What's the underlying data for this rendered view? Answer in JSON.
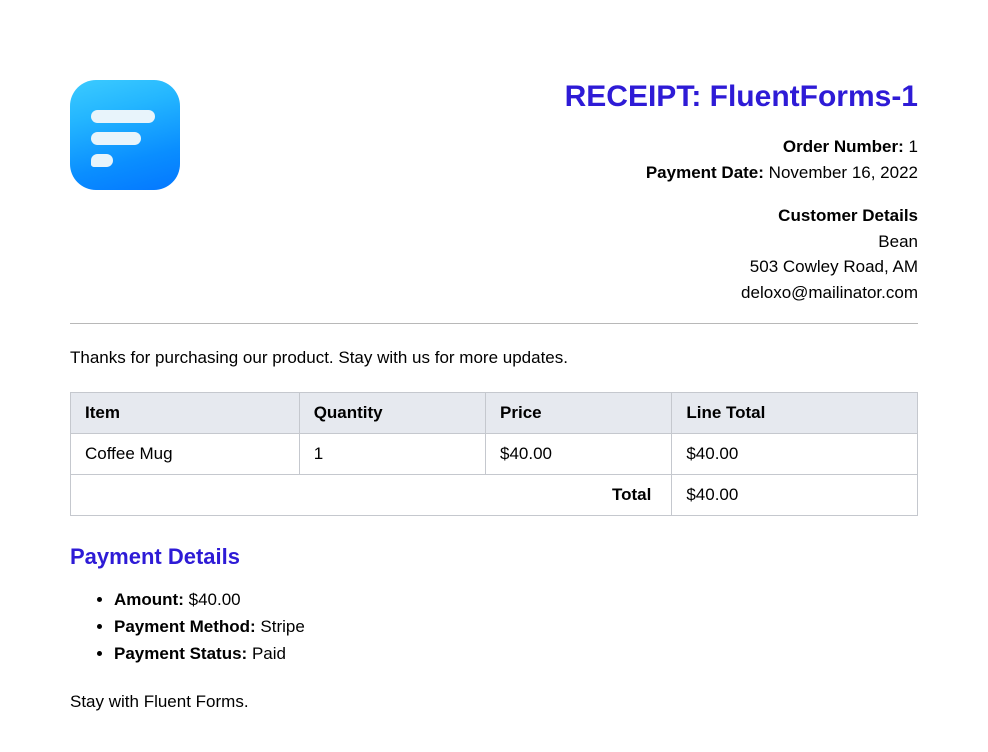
{
  "receipt": {
    "title": "RECEIPT: FluentForms-1",
    "order_number_label": "Order Number:",
    "order_number": "1",
    "payment_date_label": "Payment Date:",
    "payment_date": "November 16, 2022",
    "customer_details_label": "Customer Details",
    "customer_name": "Bean",
    "customer_address": "503 Cowley Road, AM",
    "customer_email": "deloxo@mailinator.com"
  },
  "thanks": "Thanks for purchasing our product. Stay with us for more updates.",
  "table": {
    "headers": {
      "item": "Item",
      "quantity": "Quantity",
      "price": "Price",
      "line_total": "Line Total"
    },
    "rows": [
      {
        "item": "Coffee Mug",
        "quantity": "1",
        "price": "$40.00",
        "line_total": "$40.00"
      }
    ],
    "total_label": "Total",
    "total_value": "$40.00"
  },
  "payment": {
    "heading": "Payment Details",
    "amount_label": "Amount:",
    "amount_value": "$40.00",
    "method_label": "Payment Method:",
    "method_value": "Stripe",
    "status_label": "Payment Status:",
    "status_value": "Paid"
  },
  "footer": "Stay with Fluent Forms."
}
